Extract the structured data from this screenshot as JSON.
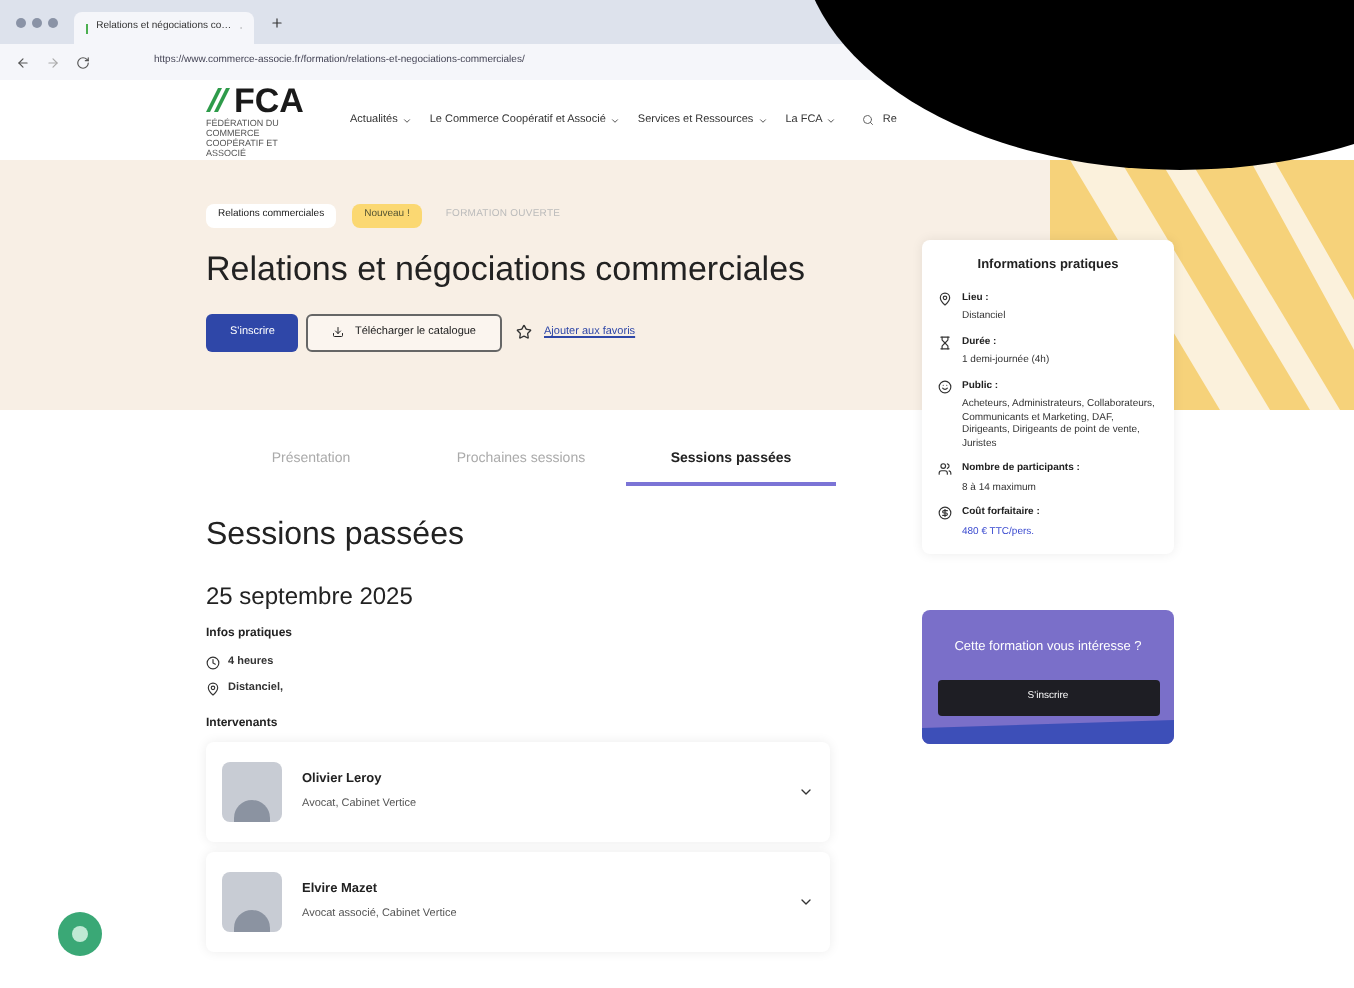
{
  "browser": {
    "tab_title": "Relations et négociations co…",
    "url": "https://www.commerce-associe.fr/formation/relations-et-negociations-commerciales/"
  },
  "nav": {
    "logo": "FCA",
    "logo_subtitle": "FÉDÉRATION DU COMMERCE COOPÉRATIF ET ASSOCIÉ",
    "links": [
      {
        "label": "Actualités"
      },
      {
        "label": "Le Commerce Coopératif et Associé"
      },
      {
        "label": "Services et Ressources"
      },
      {
        "label": "La FCA"
      }
    ],
    "search": "Re"
  },
  "hero": {
    "tags": [
      {
        "label": "Relations commerciales",
        "kind": "category"
      },
      {
        "label": "Nouveau !",
        "kind": "new"
      },
      {
        "label": "FORMATION OUVERTE",
        "kind": "status"
      }
    ],
    "title": "Relations et négociations commerciales",
    "primary_button": "S'inscrire",
    "download_button": "Télécharger le catalogue",
    "favorite_link": "Ajouter aux favoris"
  },
  "tabs": [
    {
      "label": "Présentation",
      "selected": false
    },
    {
      "label": "Prochaines sessions",
      "selected": false
    },
    {
      "label": "Sessions passées",
      "selected": true
    }
  ],
  "section": {
    "heading": "Sessions passées",
    "date": "25 septembre 2025",
    "infos_label": "Infos pratiques",
    "infos": [
      {
        "kind": "duration",
        "text": "4 heures"
      },
      {
        "kind": "location",
        "text": "Distanciel,"
      }
    ],
    "speakers_label": "Intervenants",
    "speakers": [
      {
        "name": "Olivier Leroy",
        "role": "Avocat, Cabinet Vertice",
        "expanded": false
      },
      {
        "name": "Elvire Mazet",
        "role": "Avocat associé, Cabinet Vertice",
        "expanded": false
      }
    ]
  },
  "info_card": {
    "title": "Informations pratiques",
    "items": [
      {
        "kind": "location",
        "label": "Lieu :",
        "value": "Distanciel"
      },
      {
        "kind": "duration",
        "label": "Durée :",
        "value": "1 demi-journée (4h)"
      },
      {
        "kind": "audience",
        "label": "Public :",
        "value": "Acheteurs, Administrateurs, Collaborateurs, Communicants et Marketing, DAF, Dirigeants, Dirigeants de point de vente, Juristes"
      },
      {
        "kind": "participants",
        "label": "Nombre de participants :",
        "value": "8 à 14 maximum"
      },
      {
        "kind": "price",
        "label": "Coût forfaitaire :",
        "value": "480 € TTC/pers."
      }
    ]
  },
  "cta_card": {
    "title": "Cette formation vous intéresse ?",
    "button": "S'inscrire"
  }
}
